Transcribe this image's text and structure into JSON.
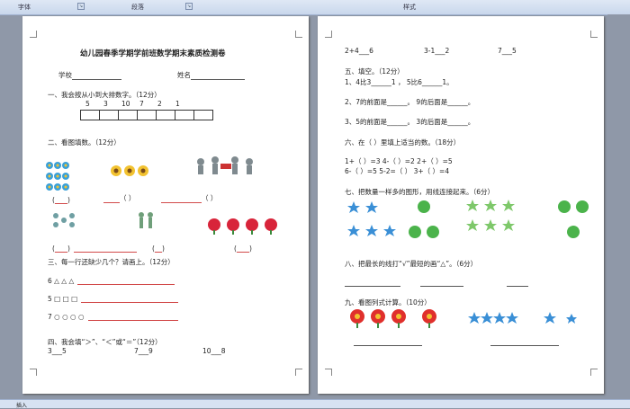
{
  "ribbon": {
    "font_group": "字体",
    "paragraph_group": "段落",
    "styles_group": "样式"
  },
  "status": {
    "mode": "插入"
  },
  "page1": {
    "title": "幼儿园春季学期学前班数学期末素质检测卷",
    "school_label": "学校",
    "name_label": "姓名",
    "q1": "一、我会按从小到大排数字。（12分）",
    "q1_numbers": [
      "5",
      "3",
      "10",
      "7",
      "2",
      "1"
    ],
    "q2": "二、看图填数。（12分）",
    "paren": "(      )",
    "q3": "三、每一行还缺少几个？请画上。（12分）",
    "q3_rows": [
      "6 △  △  △",
      "5 □  □  □",
      "7 ○  ○  ○  ○"
    ],
    "q4": "四、我会填“＞”、“＜”或“＝”（12分）",
    "q4_items": [
      "3___5",
      "7___9",
      "10___8"
    ]
  },
  "page2": {
    "top_items": [
      "2+4___6",
      "3-1___2",
      "7___5"
    ],
    "q5": "五、填空。（12分）",
    "q5_lines": [
      "1、4比3______1  ，  5比6______1。",
      "2、7的前面是______。  9的后面是______。",
      "3、5的前面是______。  3的后面是______。"
    ],
    "q6": "六、在（  ）里填上适当的数。（18分）",
    "q6_lines": [
      "1+（   ）=3   4-（   ）=2   2+（   ）=5",
      "6-（   ）=5   5-2=（   ）   3+（   ）=4"
    ],
    "q7": "七、把数量一样多的图形，用线连接起来。（6分）",
    "q8": "八、把最长的线打“√”最短的画“△”。（6分）",
    "q9": "九、看图列式计算。（10分）"
  },
  "colors": {
    "accent_red": "#d24a4a",
    "star_blue": "#3a8fd6",
    "green": "#4bb34b"
  }
}
